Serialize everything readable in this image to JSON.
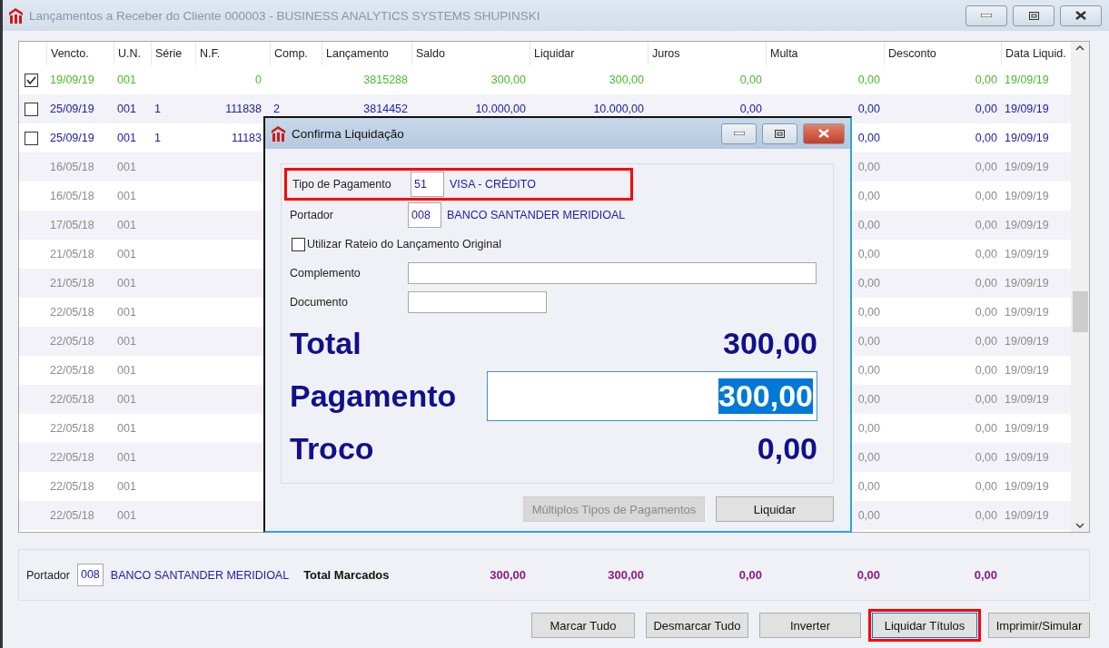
{
  "window": {
    "title": "Lançamentos a Receber do Cliente 000003 - BUSINESS ANALYTICS SYSTEMS SHUPINSKI"
  },
  "table": {
    "columns": [
      "Vencto.",
      "U.N.",
      "Série",
      "N.F.",
      "Comp.",
      "Lançamento",
      "Saldo",
      "Liquidar",
      "Juros",
      "Multa",
      "Desconto",
      "Data Liquid."
    ],
    "rows": [
      {
        "color": "#4cb82c",
        "checked": true,
        "cells": [
          "19/09/19",
          "001",
          null,
          "0",
          null,
          "3815288",
          "300,00",
          "300,00",
          "0,00",
          "0,00",
          "0,00",
          "19/09/19"
        ]
      },
      {
        "color": "#2020a8",
        "checked": false,
        "cells": [
          "25/09/19",
          "001",
          "1",
          "111838",
          "2",
          "3814452",
          "10.000,00",
          "10.000,00",
          "0,00",
          "0,00",
          "0,00",
          "19/09/19"
        ]
      },
      {
        "color": "#2020a8",
        "checked": false,
        "cells": [
          "25/09/19",
          "001",
          "1",
          "11183",
          null,
          null,
          null,
          null,
          null,
          "0,00",
          "0,00",
          "19/09/19"
        ]
      },
      {
        "color": "#8c8c8c",
        "cells": [
          "16/05/18",
          "001",
          null,
          null,
          null,
          null,
          null,
          null,
          null,
          "0,00",
          "0,00",
          "19/09/19"
        ]
      },
      {
        "color": "#8c8c8c",
        "cells": [
          "16/05/18",
          "001",
          null,
          null,
          null,
          null,
          null,
          null,
          null,
          "0,00",
          "0,00",
          "19/09/19"
        ]
      },
      {
        "color": "#8c8c8c",
        "cells": [
          "17/05/18",
          "001",
          null,
          null,
          null,
          null,
          null,
          null,
          null,
          "0,00",
          "0,00",
          "19/09/19"
        ]
      },
      {
        "color": "#8c8c8c",
        "cells": [
          "21/05/18",
          "001",
          null,
          null,
          null,
          null,
          null,
          null,
          null,
          "0,00",
          "0,00",
          "19/09/19"
        ]
      },
      {
        "color": "#8c8c8c",
        "cells": [
          "21/05/18",
          "001",
          null,
          null,
          null,
          null,
          null,
          null,
          null,
          "0,00",
          "0,00",
          "19/09/19"
        ]
      },
      {
        "color": "#8c8c8c",
        "cells": [
          "22/05/18",
          "001",
          null,
          null,
          null,
          null,
          null,
          null,
          null,
          "0,00",
          "0,00",
          "19/09/19"
        ]
      },
      {
        "color": "#8c8c8c",
        "cells": [
          "22/05/18",
          "001",
          null,
          null,
          null,
          null,
          null,
          null,
          null,
          "0,00",
          "0,00",
          "19/09/19"
        ]
      },
      {
        "color": "#8c8c8c",
        "cells": [
          "22/05/18",
          "001",
          null,
          null,
          null,
          null,
          null,
          null,
          null,
          "0,00",
          "0,00",
          "19/09/19"
        ]
      },
      {
        "color": "#8c8c8c",
        "cells": [
          "22/05/18",
          "001",
          null,
          null,
          null,
          null,
          null,
          null,
          null,
          "0,00",
          "0,00",
          "19/09/19"
        ]
      },
      {
        "color": "#8c8c8c",
        "cells": [
          "22/05/18",
          "001",
          null,
          null,
          null,
          null,
          null,
          null,
          null,
          "0,00",
          "0,00",
          "19/09/19"
        ]
      },
      {
        "color": "#8c8c8c",
        "cells": [
          "22/05/18",
          "001",
          null,
          null,
          null,
          null,
          null,
          null,
          null,
          "0,00",
          "0,00",
          "19/09/19"
        ]
      },
      {
        "color": "#8c8c8c",
        "cells": [
          "22/05/18",
          "001",
          null,
          null,
          null,
          null,
          null,
          null,
          null,
          "0,00",
          "0,00",
          "19/09/19"
        ]
      },
      {
        "color": "#8c8c8c",
        "cells": [
          "22/05/18",
          "001",
          null,
          null,
          null,
          null,
          null,
          null,
          null,
          "0,00",
          "0,00",
          "19/09/19"
        ]
      }
    ]
  },
  "footer": {
    "portador_label": "Portador",
    "portador_code": "008",
    "portador_name": "BANCO SANTANDER MERIDIOAL",
    "total_label": "Total Marcados",
    "totals": [
      "300,00",
      "300,00",
      "0,00",
      "0,00",
      "0,00"
    ]
  },
  "buttons": [
    {
      "label": "Marcar Tudo",
      "highlighted": false
    },
    {
      "label": "Desmarcar Tudo",
      "highlighted": false
    },
    {
      "label": "Inverter",
      "highlighted": false
    },
    {
      "label": "Liquidar Títulos",
      "highlighted": true
    },
    {
      "label": "Imprimir/Simular",
      "highlighted": false
    }
  ],
  "dialog": {
    "title": "Confirma Liquidação",
    "fields": [
      {
        "label": "Tipo de Pagamento",
        "code": "51",
        "name": "VISA - CRÉDITO",
        "highlighted": true
      },
      {
        "label": "Portador",
        "code": "008",
        "name": "BANCO SANTANDER MERIDIOAL",
        "highlighted": false
      }
    ],
    "checkbox": {
      "label": "Utilizar Rateio do Lançamento Original",
      "checked": false
    },
    "text_fields": [
      {
        "label": "Complemento",
        "kind": "wide"
      },
      {
        "label": "Documento",
        "kind": "short"
      }
    ],
    "amounts": [
      {
        "label": "Total",
        "value": "300,00",
        "kind": "text"
      },
      {
        "label": "Pagamento",
        "value": "300,00",
        "kind": "input",
        "selected": true
      },
      {
        "label": "Troco",
        "value": "0,00",
        "kind": "text"
      }
    ],
    "buttons": [
      {
        "label": "Múltiplos Tipos de Pagamentos",
        "disabled": true
      },
      {
        "label": "Liquidar",
        "disabled": false
      }
    ]
  }
}
